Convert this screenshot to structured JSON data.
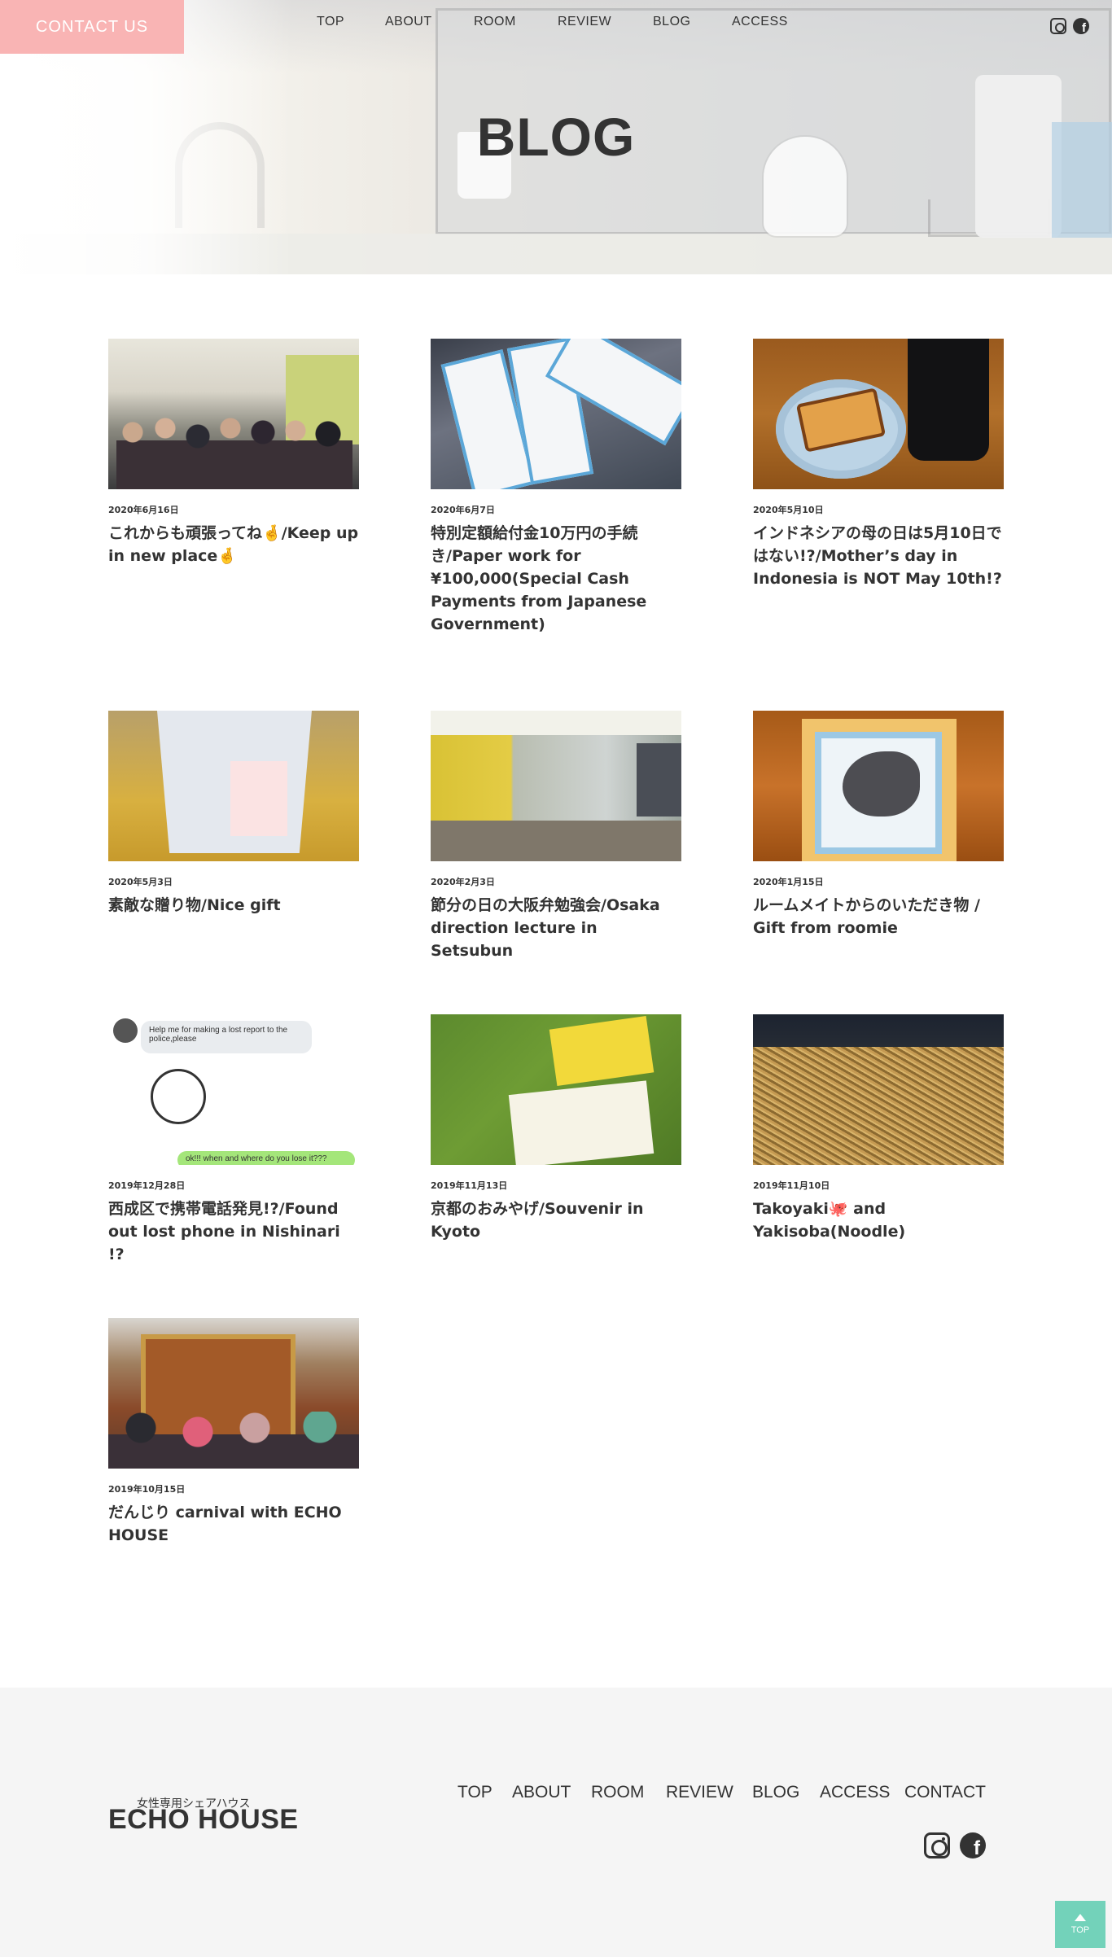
{
  "header": {
    "contact_button": "CONTACT US",
    "nav": [
      "TOP",
      "ABOUT",
      "ROOM",
      "REVIEW",
      "BLOG",
      "ACCESS"
    ],
    "social": [
      "instagram-icon",
      "facebook-icon"
    ]
  },
  "hero": {
    "title": "BLOG"
  },
  "posts": [
    {
      "date": "2020年6月16日",
      "title": "これからも頑張ってね🤞/Keep up in new place🤞"
    },
    {
      "date": "2020年6月7日",
      "title": "特別定額給付金10万円の手続き/Paper work for ¥100,000(Special Cash Payments from Japanese Government)"
    },
    {
      "date": "2020年5月10日",
      "title": "インドネシアの母の日は5月10日ではない!?/Mother’s day in Indonesia is NOT May 10th!?"
    },
    {
      "date": "2020年5月3日",
      "title": "素敵な贈り物/Nice gift"
    },
    {
      "date": "2020年2月3日",
      "title": "節分の日の大阪弁勉強会/Osaka direction lecture in Setsubun"
    },
    {
      "date": "2020年1月15日",
      "title": "ルームメイトからのいただき物 / Gift from roomie"
    },
    {
      "date": "2019年12月28日",
      "title": "西成区で携帯電話発見!?/Found out lost phone in Nishinari !?"
    },
    {
      "date": "2019年11月13日",
      "title": "京都のおみやげ/Souvenir in Kyoto"
    },
    {
      "date": "2019年11月10日",
      "title": "Takoyaki🐙 and Yakisoba(Noodle)"
    },
    {
      "date": "2019年10月15日",
      "title": "だんじり carnival with ECHO HOUSE"
    }
  ],
  "thumb_text": {
    "chat_request": "Help me for making a lost report to the police,please",
    "chat_reply": "ok!!! when and where do you lose it???"
  },
  "footer": {
    "subtitle": "女性専用シェアハウス",
    "logo": "ECHO HOUSE",
    "nav": [
      "TOP",
      "ABOUT",
      "ROOM",
      "REVIEW",
      "BLOG",
      "ACCESS",
      "CONTACT"
    ],
    "social": [
      "instagram-icon",
      "facebook-icon"
    ],
    "to_top": "TOP"
  },
  "colors": {
    "contact_bg": "#f9b4b4",
    "to_top_bg": "#73d2ba",
    "footer_bg": "#f5f5f5",
    "text": "#333333"
  }
}
